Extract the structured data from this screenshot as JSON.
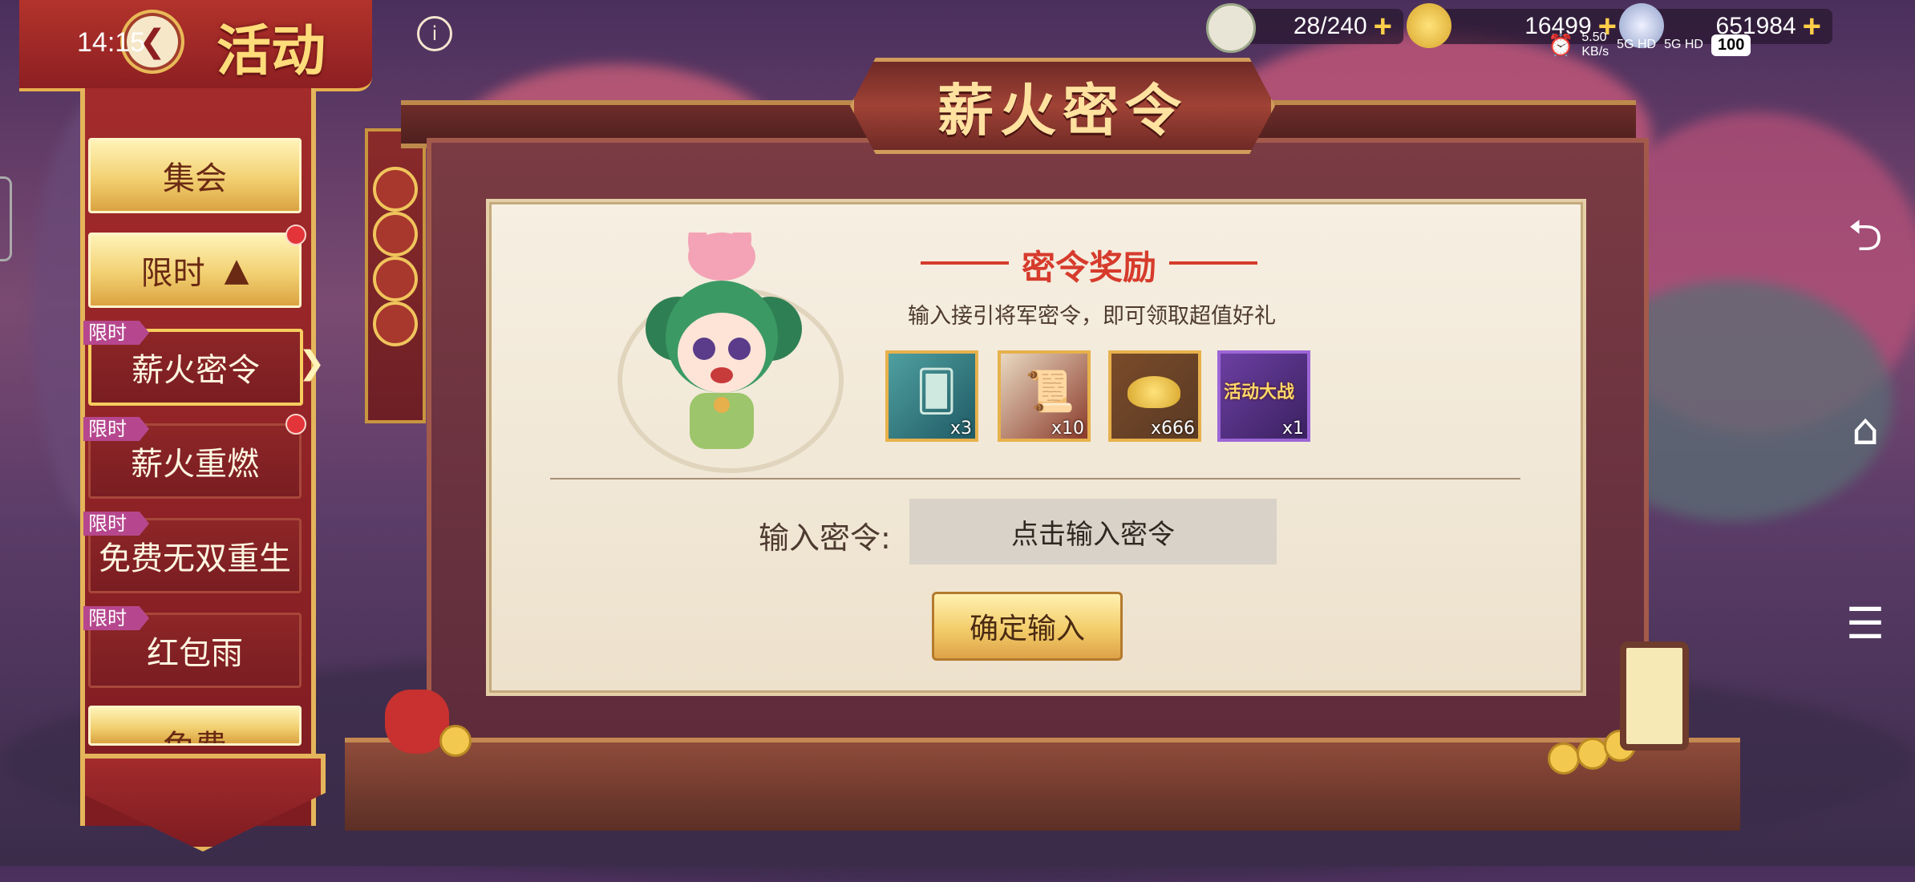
{
  "status_bar": {
    "time": "14:15",
    "net_speed": "5.50",
    "net_unit": "KB/s",
    "network1": "5G HD",
    "network2": "5G HD",
    "battery": "100"
  },
  "header": {
    "title": "活动",
    "info": "i"
  },
  "resources": [
    {
      "icon": "bun-icon",
      "value": "28/240"
    },
    {
      "icon": "gold-ingot-icon",
      "value": "16499"
    },
    {
      "icon": "silver-coin-icon",
      "value": "651984"
    }
  ],
  "left_menu": {
    "items": [
      {
        "label": "集会"
      },
      {
        "label": "限时"
      },
      {
        "tag": "限时",
        "label": "薪火密令"
      },
      {
        "tag": "限时",
        "label": "薪火重燃"
      },
      {
        "tag": "限时",
        "label": "免费无双重生"
      },
      {
        "tag": "限时",
        "label": "红包雨"
      },
      {
        "label": "免费"
      }
    ]
  },
  "main": {
    "title": "薪火密令",
    "reward_title": "密令奖励",
    "subtitle": "输入接引将军密令，即可领取超值好礼",
    "rewards": [
      {
        "icon": "dragon-card-icon",
        "qty": "x3"
      },
      {
        "icon": "scroll-icon",
        "qty": "x10"
      },
      {
        "icon": "gold-ingot-icon",
        "qty": "x666"
      },
      {
        "icon": "event-badge-icon",
        "qty": "x1",
        "label": "活动大战"
      }
    ],
    "input_label": "输入密令:",
    "input_placeholder": "点击输入密令",
    "confirm_label": "确定输入"
  },
  "colors": {
    "accent_red": "#d63b2c",
    "gold": "#f2d071",
    "menu_red": "#8d2627",
    "tag_purple": "#b6478e"
  },
  "nav_icons": [
    "back-icon",
    "home-icon",
    "menu-icon"
  ]
}
